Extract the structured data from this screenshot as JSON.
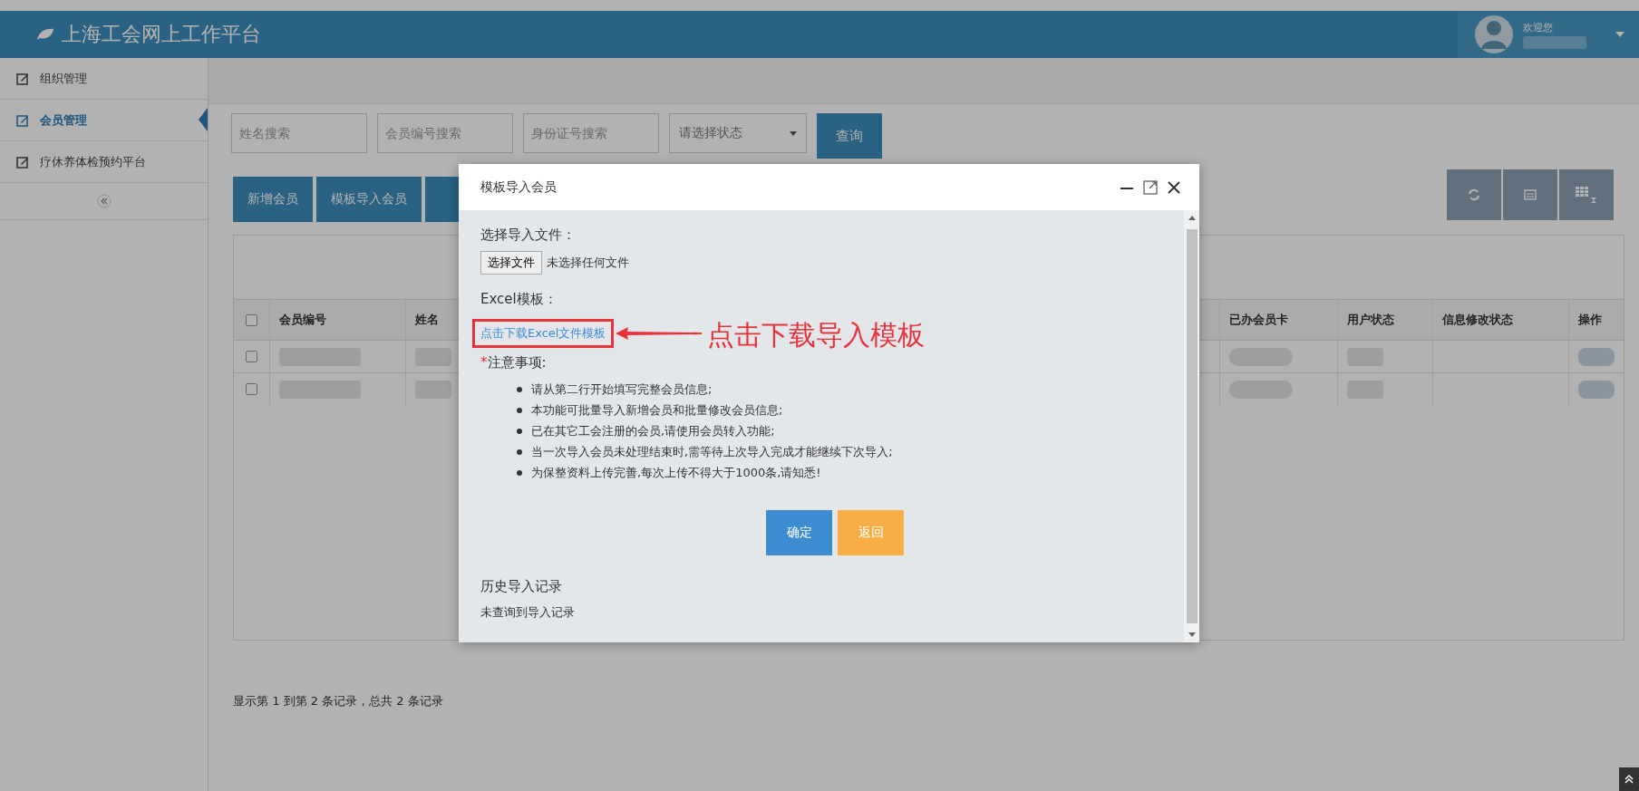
{
  "header": {
    "title": "上海工会网上工作平台",
    "greeting": "欢迎您"
  },
  "sidebar": {
    "items": [
      {
        "label": "组织管理",
        "selected": false
      },
      {
        "label": "会员管理",
        "selected": true
      },
      {
        "label": "疗休养体检预约平台",
        "selected": false
      }
    ]
  },
  "search": {
    "fields": [
      {
        "placeholder": "姓名搜索"
      },
      {
        "placeholder": "会员编号搜索"
      },
      {
        "placeholder": "身份证号搜索"
      }
    ],
    "select": "请选择状态",
    "button": "查询"
  },
  "toolbar": {
    "buttons": [
      "新增会员",
      "模板导入会员"
    ]
  },
  "table": {
    "columns": [
      "会员编号",
      "姓名",
      "已办会员卡",
      "用户状态",
      "信息修改状态",
      "操作"
    ],
    "select_all_checked": false,
    "rows": [
      {
        "checked": false
      },
      {
        "checked": false
      }
    ]
  },
  "footer": "显示第 1 到第 2 条记录，总共 2 条记录",
  "modal": {
    "title": "模板导入会员",
    "file_label": "选择导入文件：",
    "file_button": "选择文件",
    "file_status": "未选择任何文件",
    "template_label": "Excel模板：",
    "template_link": "点击下载Excel文件模板",
    "notes_mark": "*",
    "notes_title": "注意事项:",
    "notes": [
      "请从第二行开始填写完整会员信息;",
      "本功能可批量导入新增会员和批量修改会员信息;",
      "已在其它工会注册的会员,请使用会员转入功能;",
      "当一次导入会员未处理结束时,需等待上次导入完成才能继续下次导入;",
      "为保整资料上传完善,每次上传不得大于1000条,请知悉!"
    ],
    "confirm": "确定",
    "back": "返回",
    "history_title": "历史导入记录",
    "history_empty": "未查询到导入记录"
  },
  "annotation": "点击下载导入模板"
}
